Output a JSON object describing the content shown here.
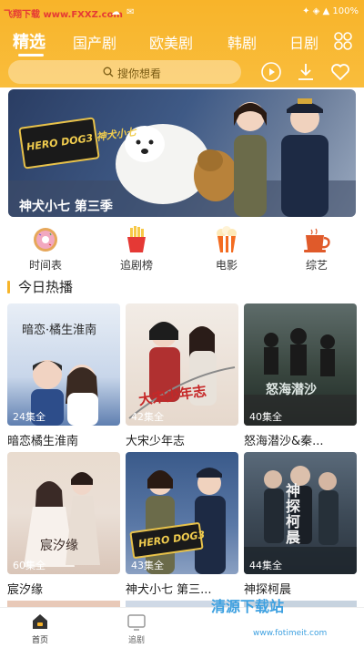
{
  "statusbar": {
    "watermark": "飞翔下载 www.FXXZ.com",
    "left_icons": "☁ ✉",
    "right": "✦ ◈ ▲ 100%"
  },
  "tabs": [
    {
      "label": "精选"
    },
    {
      "label": "国产剧"
    },
    {
      "label": "欧美剧"
    },
    {
      "label": "韩剧"
    },
    {
      "label": "日剧"
    }
  ],
  "search": {
    "placeholder": "搜你想看"
  },
  "banner": {
    "title": "神犬小七 第三季",
    "logo": "HERO DOG3 神犬小七"
  },
  "quick_links": [
    {
      "label": "时间表",
      "icon": "donut-icon"
    },
    {
      "label": "追剧榜",
      "icon": "fries-icon"
    },
    {
      "label": "电影",
      "icon": "popcorn-icon"
    },
    {
      "label": "综艺",
      "icon": "cup-icon"
    }
  ],
  "section": {
    "title": "今日热播"
  },
  "cards": [
    {
      "title": "暗恋橘生淮南",
      "episodes": "24集全",
      "poster_text": "暗恋·橘生淮南"
    },
    {
      "title": "大宋少年志",
      "episodes": "42集全",
      "poster_text": "大宋少年志"
    },
    {
      "title": "怒海潜沙&秦...",
      "episodes": "40集全",
      "poster_text": "怒海潜沙"
    },
    {
      "title": "宸汐缘",
      "episodes": "60集全",
      "poster_text": "宸汐缘"
    },
    {
      "title": "神犬小七 第三...",
      "episodes": "43集全",
      "poster_text": "HERO DOG3"
    },
    {
      "title": "神探柯晨",
      "episodes": "44集全",
      "poster_text": "神探柯晨"
    }
  ],
  "bottom_nav": [
    {
      "label": "首页",
      "icon": "home-icon"
    },
    {
      "label": "追剧",
      "icon": "tv-icon"
    }
  ],
  "watermark_bottom": {
    "main": "清源下载站",
    "url": "www.fotimeit.com"
  },
  "colors": {
    "accent": "#f8b42a",
    "active_tab": "#ffffff"
  }
}
